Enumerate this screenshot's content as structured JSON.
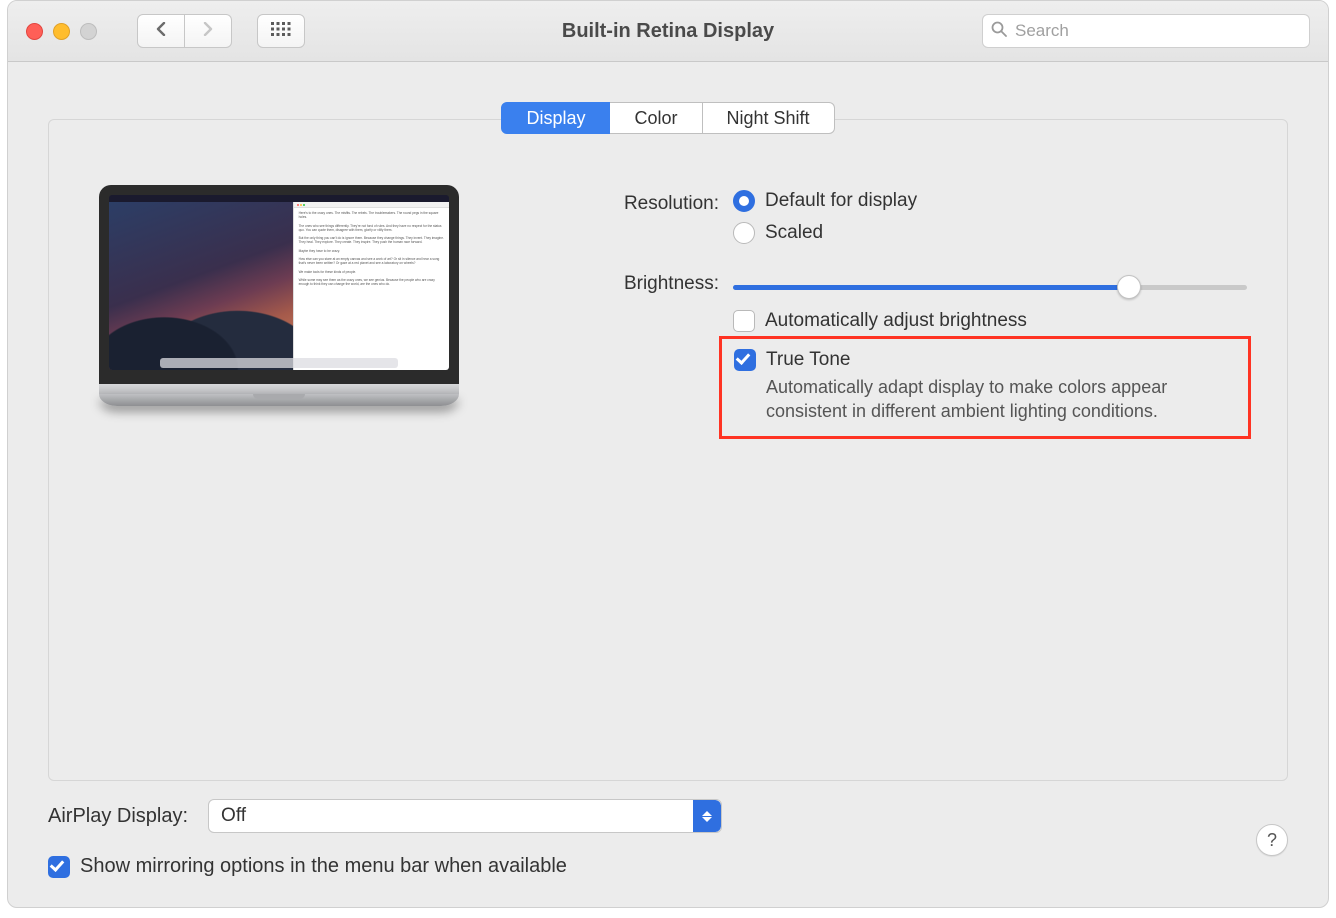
{
  "window_title": "Built-in Retina Display",
  "search_placeholder": "Search",
  "tabs": {
    "display": "Display",
    "color": "Color",
    "night_shift": "Night Shift"
  },
  "resolution": {
    "label": "Resolution:",
    "default": "Default for display",
    "scaled": "Scaled"
  },
  "brightness": {
    "label": "Brightness:",
    "auto_label": "Automatically adjust brightness",
    "percent": 77
  },
  "true_tone": {
    "label": "True Tone",
    "desc": "Automatically adapt display to make colors appear consistent in different ambient lighting conditions."
  },
  "airplay": {
    "label": "AirPlay Display:",
    "value": "Off"
  },
  "mirroring": {
    "label": "Show mirroring options in the menu bar when available"
  },
  "help_glyph": "?"
}
